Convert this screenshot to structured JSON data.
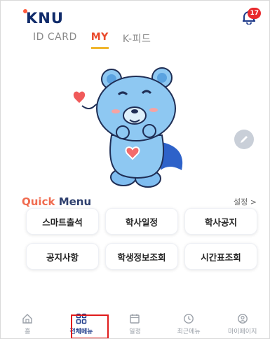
{
  "header": {
    "logo_text": "KNU",
    "notification_count": "17"
  },
  "tabs": [
    {
      "label": "ID CARD",
      "active": false
    },
    {
      "label": "MY",
      "active": true
    },
    {
      "label": "K-피드",
      "active": false
    }
  ],
  "quick_menu": {
    "title_quick": "Quick",
    "title_menu": "Menu",
    "settings_label": "설정 >",
    "items": [
      "스마트출석",
      "학사일정",
      "학사공지",
      "공지사항",
      "학생정보조회",
      "시간표조회"
    ]
  },
  "bottom_nav": [
    {
      "label": "홈",
      "icon": "home-icon",
      "active": false
    },
    {
      "label": "전체메뉴",
      "icon": "grid-icon",
      "active": true
    },
    {
      "label": "일정",
      "icon": "calendar-icon",
      "active": false
    },
    {
      "label": "최근메뉴",
      "icon": "clock-icon",
      "active": false
    },
    {
      "label": "마이페이지",
      "icon": "user-icon",
      "active": false
    }
  ],
  "colors": {
    "accent": "#e94a2c",
    "brand_navy": "#102b6a",
    "tab_underline": "#f0b62f",
    "badge": "#e8292d",
    "bear_blue": "#8ec8f2"
  }
}
